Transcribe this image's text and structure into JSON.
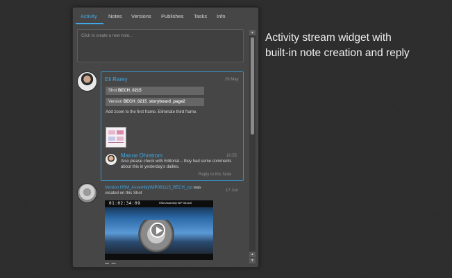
{
  "tabs": [
    "Activity",
    "Notes",
    "Versions",
    "Publishes",
    "Tasks",
    "Info"
  ],
  "note_input": {
    "placeholder": "Click to create a new note..."
  },
  "note": {
    "author": "Eli Rarey",
    "date": "26 May",
    "shot_prefix": "Shot",
    "shot_name": "BECH_0215",
    "version_prefix": "Version",
    "version_name": "BECH_0215_storyboard_page2",
    "text": "Add zoom to the first frame. Eliminate third frame.",
    "reply": {
      "author": "Manne Ohrstrom",
      "time": "10:55",
      "text": "Also please check with Editorial – they had some comments about this in yesterday's dailies."
    },
    "reply_link": "Reply to this Note"
  },
  "version_event": {
    "version_label": "Version HSM_AssemblyWIP061115_BECH_cut",
    "was": "was",
    "created_text": "created on this Shot",
    "date": "17 Jun",
    "timecode": "01:02:34:09",
    "video_title": "HSM Assembly WIP 061115"
  },
  "caption": {
    "line1": "Activity stream widget with",
    "line2": "built-in note creation and reply"
  },
  "colors": {
    "accent": "#3fa9e6",
    "panel": "#464646",
    "background": "#2d2d2d"
  }
}
